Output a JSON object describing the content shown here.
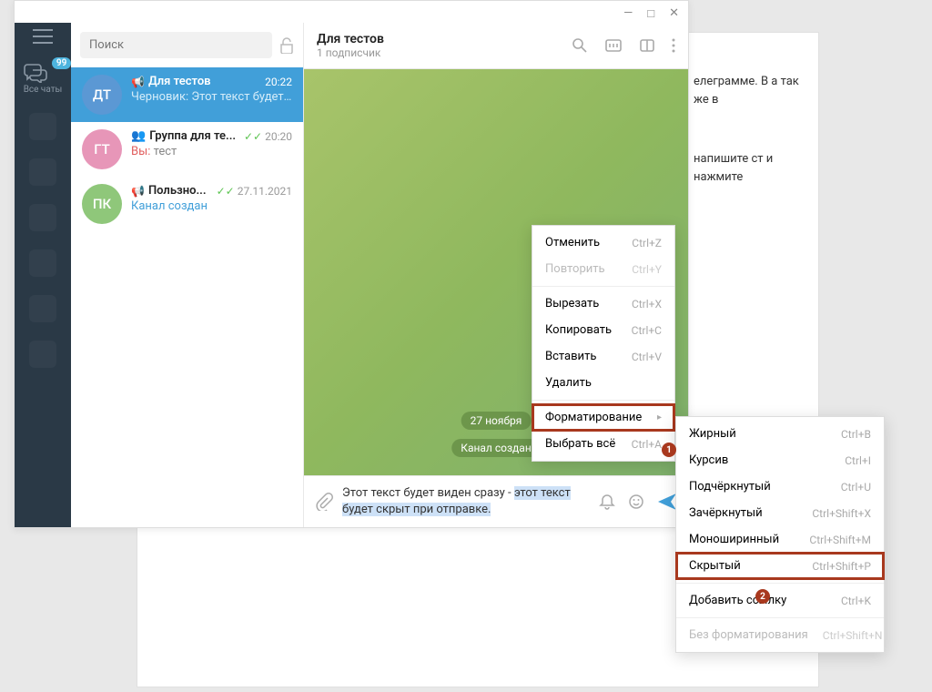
{
  "window": {
    "minimize": "—",
    "maximize": "□",
    "close": "✕"
  },
  "leftbar": {
    "badge_count": "99",
    "all_chats": "Все чаты"
  },
  "search": {
    "placeholder": "Поиск"
  },
  "chats": [
    {
      "avatar_initials": "ДТ",
      "avatar_color": "#5b98d4",
      "name": "Для тестов",
      "time": "20:22",
      "preview_prefix": "Черновик:",
      "preview": "Этот текст будет ...",
      "has_megaphone": true,
      "active": true
    },
    {
      "avatar_initials": "ГТ",
      "avatar_color": "#e796b8",
      "name": "Группа для те...",
      "time": "20:20",
      "preview_prefix": "Вы:",
      "preview": "тест",
      "has_checks": true,
      "has_group": true
    },
    {
      "avatar_initials": "ПК",
      "avatar_color": "#8fc77a",
      "name": "Пользно...",
      "time": "27.11.2021",
      "preview": "Канал создан",
      "preview_is_link": true,
      "has_megaphone": true,
      "has_checks": true
    }
  ],
  "chat_header": {
    "name": "Для тестов",
    "subtitle": "1 подписчик"
  },
  "chat_body": {
    "date": "27 ноября",
    "system_msg": "Канал создан"
  },
  "input": {
    "text_visible": "Этот текст будет виден сразу - ",
    "text_selected": "этот текст будет скрыт при отправке."
  },
  "context_menu_1": [
    {
      "label": "Отменить",
      "shortcut": "Ctrl+Z"
    },
    {
      "label": "Повторить",
      "shortcut": "Ctrl+Y",
      "disabled": true
    },
    {
      "sep": true
    },
    {
      "label": "Вырезать",
      "shortcut": "Ctrl+X"
    },
    {
      "label": "Копировать",
      "shortcut": "Ctrl+C"
    },
    {
      "label": "Вставить",
      "shortcut": "Ctrl+V"
    },
    {
      "label": "Удалить"
    },
    {
      "sep": true
    },
    {
      "label": "Форматирование",
      "submenu": true,
      "highlighted": true
    },
    {
      "label": "Выбрать всё",
      "shortcut": "Ctrl+A"
    }
  ],
  "context_menu_2": [
    {
      "label": "Жирный",
      "shortcut": "Ctrl+B"
    },
    {
      "label": "Курсив",
      "shortcut": "Ctrl+I"
    },
    {
      "label": "Подчёркнутый",
      "shortcut": "Ctrl+U"
    },
    {
      "label": "Зачёркнутый",
      "shortcut": "Ctrl+Shift+X"
    },
    {
      "label": "Моноширинный",
      "shortcut": "Ctrl+Shift+M"
    },
    {
      "label": "Скрытый",
      "shortcut": "Ctrl+Shift+P",
      "highlighted": true
    },
    {
      "sep": true
    },
    {
      "label": "Добавить ссылку",
      "shortcut": "Ctrl+K"
    },
    {
      "sep": true
    },
    {
      "label": "Без форматирования",
      "shortcut": "Ctrl+Shift+N",
      "disabled": true
    }
  ],
  "markers": {
    "one": "1",
    "two": "2"
  },
  "article": {
    "frag1": "елеграмме. В а так же в",
    "frag2": "напишите ст и нажмите"
  }
}
